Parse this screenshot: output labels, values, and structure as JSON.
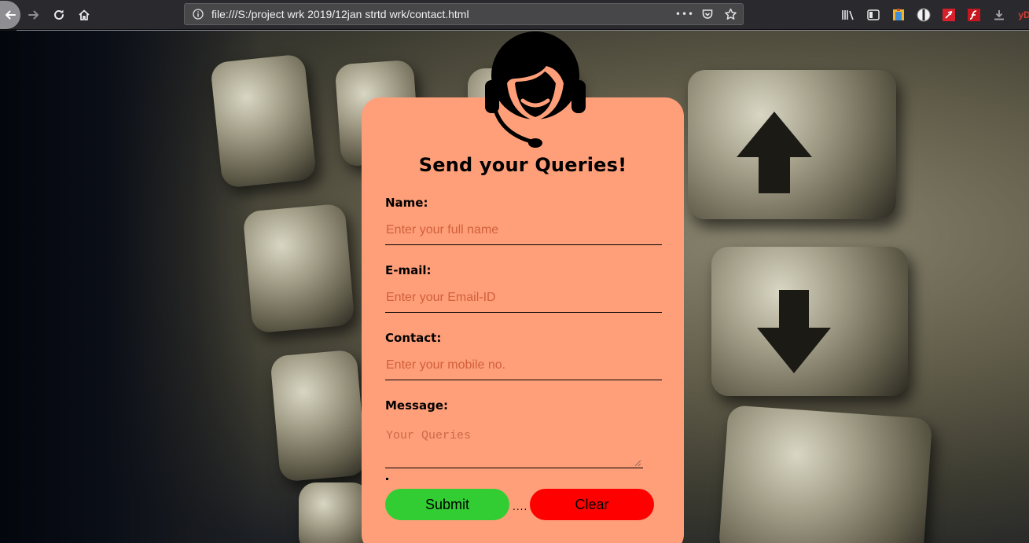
{
  "browser": {
    "url": "file:///S:/project wrk 2019/12jan strtd wrk/contact.html",
    "page_actions_label": "•••",
    "toolbar_icons": [
      "library-icon",
      "sidebar-icon",
      "extension-icon",
      "privacy-badger-icon",
      "flash-icon",
      "flash-player-icon",
      "downloads-icon",
      "extension-yd-icon"
    ],
    "extension_yd_label": "yD"
  },
  "form": {
    "title": "Send your Queries!",
    "name_label": "Name:",
    "name_placeholder": "Enter your full name",
    "email_label": "E-mail:",
    "email_placeholder": "Enter your Email-ID",
    "contact_label": "Contact:",
    "contact_placeholder": "Enter your mobile no.",
    "message_label": "Message:",
    "message_placeholder": "Your Queries",
    "submit_label": "Submit",
    "separator": "....",
    "clear_label": "Clear"
  },
  "colors": {
    "card": "#ff9f7a",
    "submit": "#32cd32",
    "clear": "#ff0000",
    "placeholder": "#d0603c"
  }
}
